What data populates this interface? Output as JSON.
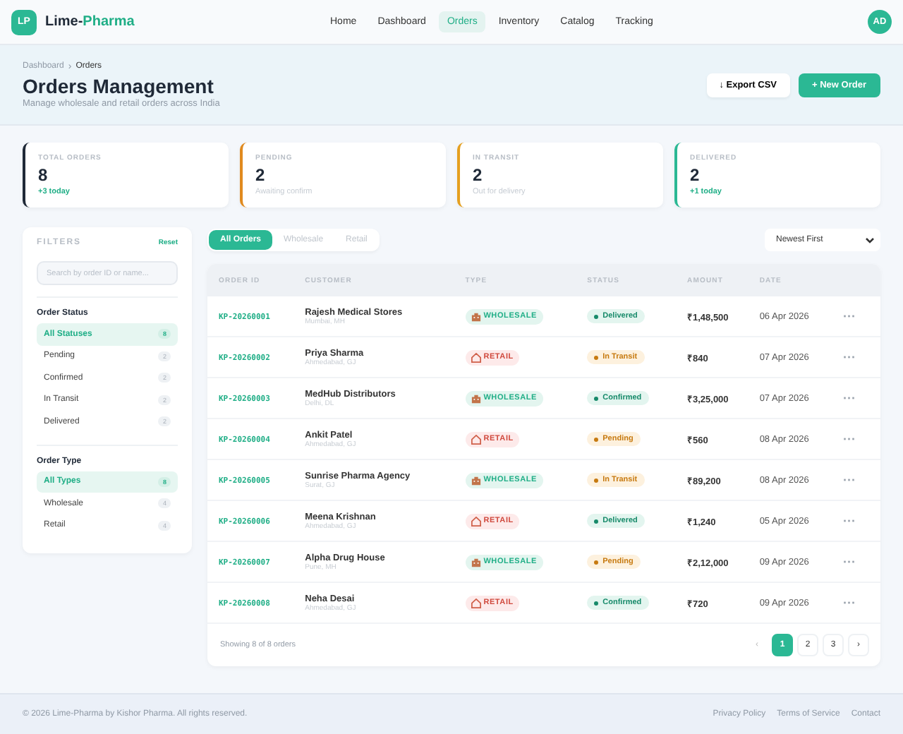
{
  "brand": {
    "logo": "LP",
    "name_a": "Lime-",
    "name_b": "Pharma"
  },
  "nav": [
    {
      "label": "Home",
      "selected": false
    },
    {
      "label": "Dashboard",
      "selected": false
    },
    {
      "label": "Orders",
      "selected": true
    },
    {
      "label": "Inventory",
      "selected": false
    },
    {
      "label": "Catalog",
      "selected": false
    },
    {
      "label": "Tracking",
      "selected": false
    }
  ],
  "avatar": "AD",
  "breadcrumb": {
    "parent": "Dashboard",
    "separator": "›",
    "current": "Orders"
  },
  "title": "Orders Management",
  "subtitle": "Manage wholesale and retail orders across India",
  "buttons": {
    "export": "↓ Export CSV",
    "new": "+ New Order"
  },
  "stats": [
    {
      "label": "TOTAL ORDERS",
      "value": "8",
      "note": "+3 today",
      "kind": "up",
      "color": "#1f2937"
    },
    {
      "label": "PENDING",
      "value": "2",
      "note": "Awaiting confirm",
      "kind": "muted",
      "color": "#e08a1e"
    },
    {
      "label": "IN TRANSIT",
      "value": "2",
      "note": "Out for delivery",
      "kind": "muted",
      "color": "#e5a020"
    },
    {
      "label": "DELIVERED",
      "value": "2",
      "note": "+1 today",
      "kind": "up",
      "color": "#2bb894"
    }
  ],
  "filters": {
    "title": "FILTERS",
    "reset": "Reset",
    "search": {
      "placeholder": "Search by order ID or name..."
    },
    "groups": [
      {
        "title": "Order Status",
        "items": [
          {
            "label": "All Statuses",
            "count": "8",
            "selected": true
          },
          {
            "label": "Pending",
            "count": "2",
            "selected": false
          },
          {
            "label": "Confirmed",
            "count": "2",
            "selected": false
          },
          {
            "label": "In Transit",
            "count": "2",
            "selected": false
          },
          {
            "label": "Delivered",
            "count": "2",
            "selected": false
          }
        ]
      },
      {
        "title": "Order Type",
        "items": [
          {
            "label": "All Types",
            "count": "8",
            "selected": true
          },
          {
            "label": "Wholesale",
            "count": "4",
            "selected": false
          },
          {
            "label": "Retail",
            "count": "4",
            "selected": false
          }
        ]
      }
    ]
  },
  "tabs": [
    {
      "label": "All Orders",
      "selected": true
    },
    {
      "label": "Wholesale",
      "selected": false
    },
    {
      "label": "Retail",
      "selected": false
    }
  ],
  "sort": {
    "value": "Newest First"
  },
  "table": {
    "columns": [
      "ORDER ID",
      "CUSTOMER",
      "TYPE",
      "STATUS",
      "AMOUNT",
      "DATE"
    ],
    "rows": [
      {
        "id": "KP-20260001",
        "customer": "Rajesh Medical Stores",
        "city": "Mumbai, MH",
        "type": {
          "label": "WHOLESALE",
          "kind": "wholesale"
        },
        "status": {
          "label": "Delivered",
          "kind": "green"
        },
        "amount": "₹1,48,500",
        "date": "06 Apr 2026",
        "actions": "···"
      },
      {
        "id": "KP-20260002",
        "customer": "Priya Sharma",
        "city": "Ahmedabad, GJ",
        "type": {
          "label": "RETAIL",
          "kind": "retail"
        },
        "status": {
          "label": "In Transit",
          "kind": "orange"
        },
        "amount": "₹840",
        "date": "07 Apr 2026",
        "actions": "···"
      },
      {
        "id": "KP-20260003",
        "customer": "MedHub Distributors",
        "city": "Delhi, DL",
        "type": {
          "label": "WHOLESALE",
          "kind": "wholesale"
        },
        "status": {
          "label": "Confirmed",
          "kind": "green"
        },
        "amount": "₹3,25,000",
        "date": "07 Apr 2026",
        "actions": "···"
      },
      {
        "id": "KP-20260004",
        "customer": "Ankit Patel",
        "city": "Ahmedabad, GJ",
        "type": {
          "label": "RETAIL",
          "kind": "retail"
        },
        "status": {
          "label": "Pending",
          "kind": "orange"
        },
        "amount": "₹560",
        "date": "08 Apr 2026",
        "actions": "···"
      },
      {
        "id": "KP-20260005",
        "customer": "Sunrise Pharma Agency",
        "city": "Surat, GJ",
        "type": {
          "label": "WHOLESALE",
          "kind": "wholesale"
        },
        "status": {
          "label": "In Transit",
          "kind": "orange"
        },
        "amount": "₹89,200",
        "date": "08 Apr 2026",
        "actions": "···"
      },
      {
        "id": "KP-20260006",
        "customer": "Meena Krishnan",
        "city": "Ahmedabad, GJ",
        "type": {
          "label": "RETAIL",
          "kind": "retail"
        },
        "status": {
          "label": "Delivered",
          "kind": "green"
        },
        "amount": "₹1,240",
        "date": "05 Apr 2026",
        "actions": "···"
      },
      {
        "id": "KP-20260007",
        "customer": "Alpha Drug House",
        "city": "Pune, MH",
        "type": {
          "label": "WHOLESALE",
          "kind": "wholesale"
        },
        "status": {
          "label": "Pending",
          "kind": "orange"
        },
        "amount": "₹2,12,000",
        "date": "09 Apr 2026",
        "actions": "···"
      },
      {
        "id": "KP-20260008",
        "customer": "Neha Desai",
        "city": "Ahmedabad, GJ",
        "type": {
          "label": "RETAIL",
          "kind": "retail"
        },
        "status": {
          "label": "Confirmed",
          "kind": "green"
        },
        "amount": "₹720",
        "date": "09 Apr 2026",
        "actions": "···"
      }
    ]
  },
  "showing": "Showing 8 of 8 orders",
  "pagination": {
    "prev": "‹",
    "next": "›",
    "pages": [
      {
        "label": "1",
        "selected": true
      },
      {
        "label": "2",
        "selected": false
      },
      {
        "label": "3",
        "selected": false
      }
    ]
  },
  "footer": {
    "copyright": "© 2026 Lime-Pharma by Kishor Pharma. All rights reserved.",
    "links": [
      "Privacy Policy",
      "Terms of Service",
      "Contact"
    ]
  }
}
